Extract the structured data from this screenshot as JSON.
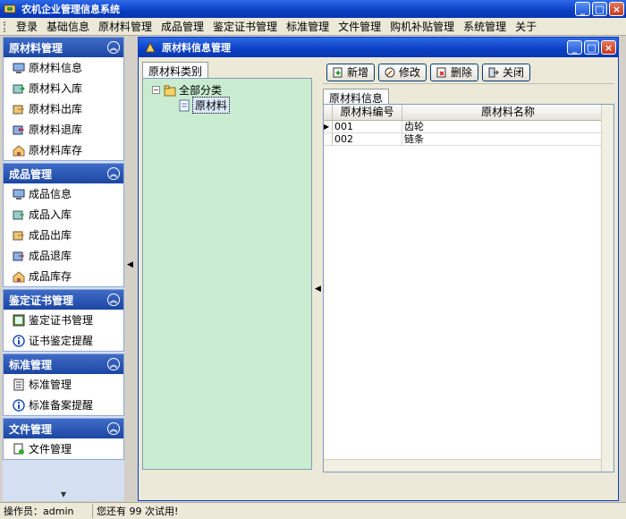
{
  "window": {
    "title": "农机企业管理信息系统",
    "minimize": "_",
    "maximize": "□",
    "close": "×"
  },
  "menubar": [
    "登录",
    "基础信息",
    "原材料管理",
    "成品管理",
    "鉴定证书管理",
    "标准管理",
    "文件管理",
    "购机补贴管理",
    "系统管理",
    "关于"
  ],
  "leftnav": {
    "groups": [
      {
        "title": "原材料管理",
        "items": [
          "原材料信息",
          "原材料入库",
          "原材料出库",
          "原材料退库",
          "原材料库存"
        ]
      },
      {
        "title": "成品管理",
        "items": [
          "成品信息",
          "成品入库",
          "成品出库",
          "成品退库",
          "成品库存"
        ]
      },
      {
        "title": "鉴定证书管理",
        "items": [
          "鉴定证书管理",
          "证书鉴定提醒"
        ]
      },
      {
        "title": "标准管理",
        "items": [
          "标准管理",
          "标准备案提醒"
        ]
      },
      {
        "title": "文件管理",
        "items": [
          "文件管理"
        ]
      }
    ],
    "collapse_glyph": "︽",
    "scroll_glyph": "▼"
  },
  "inner": {
    "title": "原材料信息管理",
    "category_tab": "原材料类别",
    "tree_root": "全部分类",
    "tree_child": "原材料",
    "toolbar": {
      "add": "新增",
      "edit": "修改",
      "delete": "删除",
      "close": "关闭"
    },
    "grid_tab": "原材料信息",
    "columns": [
      "原材料编号",
      "原材料名称"
    ],
    "rows": [
      {
        "code": "001",
        "name": "齿轮"
      },
      {
        "code": "002",
        "name": "链条"
      }
    ],
    "row_marker": "▶"
  },
  "statusbar": {
    "operator": "操作员：admin",
    "trial": "您还有 99 次试用!"
  }
}
